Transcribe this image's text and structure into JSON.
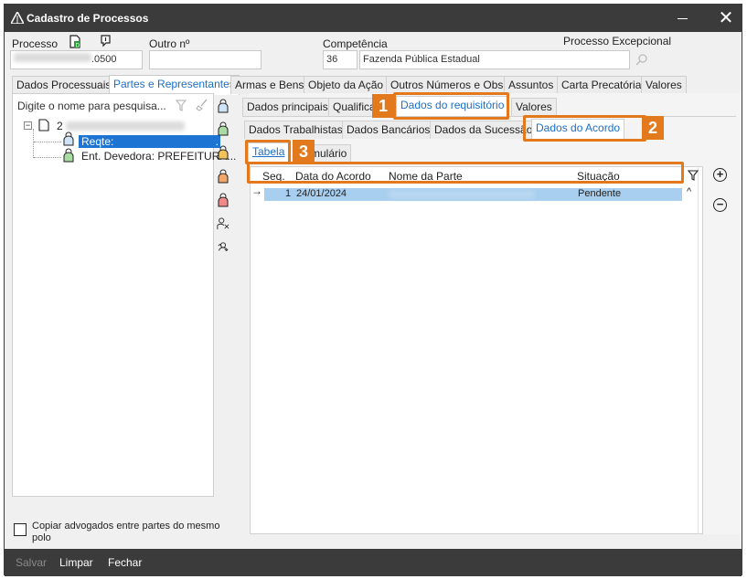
{
  "window": {
    "title": "Cadastro de Processos"
  },
  "header": {
    "processo_label": "Processo",
    "processo_value_suffix": ".0500",
    "processo_value_prefix": "",
    "outro_label": "Outro nº",
    "competencia_label": "Competência",
    "competencia_code": "36",
    "competencia_name": "Fazenda Pública Estadual",
    "excepcional_label": "Processo Excepcional"
  },
  "main_tabs": [
    "Dados Processuais",
    "Partes e Representantes",
    "Armas e Bens",
    "Objeto da Ação",
    "Outros Números e Obs.",
    "Assuntos",
    "Carta Precatória",
    "Valores"
  ],
  "left": {
    "search_placeholder": "Digite o nome para pesquisa...",
    "tree_root": "2",
    "tree_item_1": "Reqte:",
    "tree_item_1_suffix": ".",
    "tree_item_2": "Ent. Devedora: PREFEITURA..."
  },
  "sub_tabs_1": [
    "Dados principais",
    "Qualifica",
    "Dados do requisitório",
    "Valores"
  ],
  "sub_tabs_2": [
    "Dados Trabalhistas",
    "Dados Bancários",
    "Dados da Sucessão",
    "Dados do Acordo"
  ],
  "sub_tabs_3": [
    "Tabela",
    "mulário"
  ],
  "grid": {
    "columns": [
      "Seq.",
      "Data do Acordo",
      "Nome da Parte",
      "Situação"
    ],
    "rows": [
      {
        "arrow": "→",
        "seq": "1",
        "data": "24/01/2024",
        "situacao": "Pendente"
      }
    ]
  },
  "badges": [
    "1",
    "2",
    "3"
  ],
  "footer": {
    "copy_checkbox_label": "Copiar advogados entre partes do mesmo polo",
    "salvar": "Salvar",
    "limpar": "Limpar",
    "fechar": "Fechar"
  },
  "colors": {
    "accent": "#e27a1d",
    "link": "#1b6fc9",
    "selection": "#a8cfef",
    "titlebar": "#3b3b3b"
  }
}
